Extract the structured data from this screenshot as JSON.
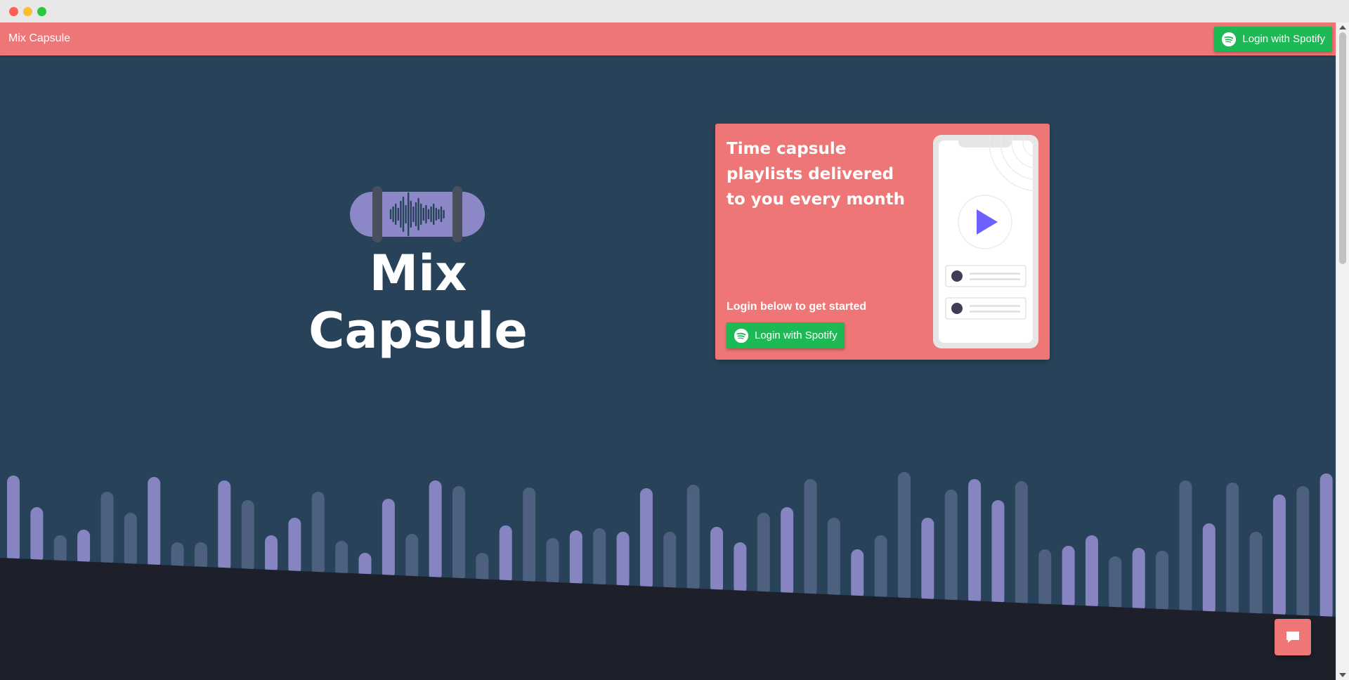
{
  "app": {
    "brand": "Mix Capsule",
    "hero_title": "Mix Capsule"
  },
  "navbar": {
    "login_label": "Login with Spotify"
  },
  "card": {
    "heading": "Time capsule playlists delivered to you every month",
    "subtext": "Login below to get started",
    "login_label": "Login with Spotify"
  },
  "icons": {
    "spotify": "spotify-icon",
    "chat": "chat-icon",
    "play": "play-icon",
    "logo": "cassette-waveform-icon"
  },
  "colors": {
    "background": "#284359",
    "accent": "#ef7676",
    "spotify_green": "#1db954",
    "bar_purple": "#8c88c8",
    "dark_footer": "#1d202b"
  }
}
